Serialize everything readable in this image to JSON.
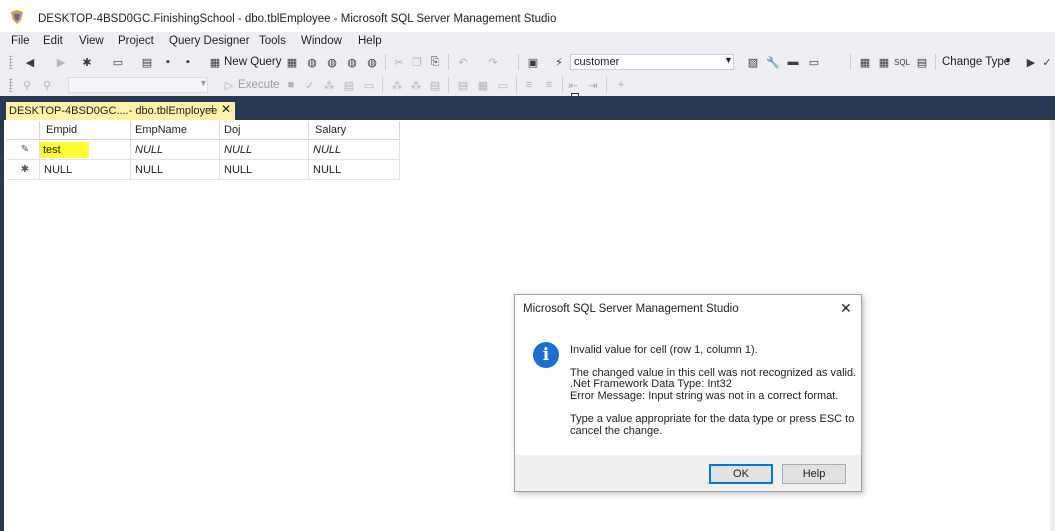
{
  "window": {
    "title": "DESKTOP-4BSD0GC.FinishingSchool - dbo.tblEmployee - Microsoft SQL Server Management Studio"
  },
  "menu": [
    "File",
    "Edit",
    "View",
    "Project",
    "Query Designer",
    "Tools",
    "Window",
    "Help"
  ],
  "toolbar": {
    "new_query_label": "New Query",
    "database_combo": "customer",
    "change_type_label": "Change Type",
    "execute_label": "Execute"
  },
  "document_tab": {
    "label": "DESKTOP-4BSD0GC....- dbo.tblEmployee",
    "pin_glyph": "⊣",
    "close_glyph": "✕"
  },
  "grid": {
    "columns": [
      "Empid",
      "EmpName",
      "Doj",
      "Salary"
    ],
    "rows": [
      {
        "indicator": "✎",
        "cells": [
          "test",
          "NULL",
          "NULL",
          "NULL"
        ]
      },
      {
        "indicator": "✱",
        "cells": [
          "NULL",
          "NULL",
          "NULL",
          "NULL"
        ]
      }
    ]
  },
  "dialog": {
    "title": "Microsoft SQL Server Management Studio",
    "line1": "Invalid value for cell (row 1, column 1).",
    "line2": "The changed value in this cell was not recognized as valid.",
    "line3": ".Net Framework Data Type: Int32",
    "line4": "Error Message: Input string was not in a correct format.",
    "line5": "Type a value appropriate for the data type or press ESC to",
    "line6": "cancel the change.",
    "ok_label": "OK",
    "help_label": "Help",
    "info_glyph": "i"
  },
  "colors": {
    "tab_bg": "#fff1a8",
    "frame": "#293955",
    "toolbar_bg": "#eeeef2",
    "highlight": "#ffff33",
    "info_blue": "#1a6fd1"
  }
}
